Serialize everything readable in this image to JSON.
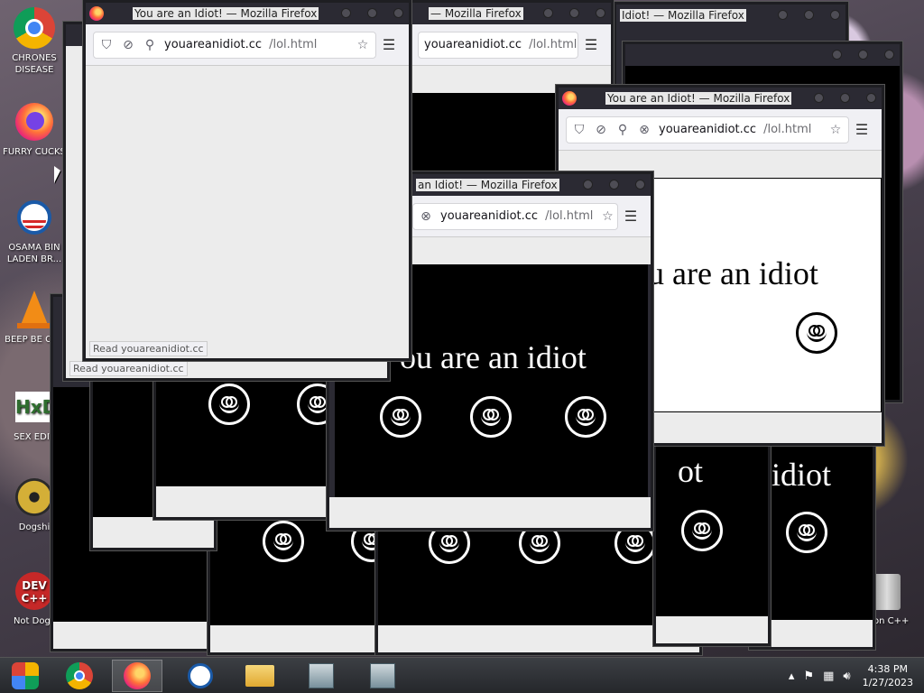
{
  "desktop": {
    "icons": [
      {
        "label": "CHRONES DISEASE",
        "icon": "chrome-icon"
      },
      {
        "label": "FURRY CUCKS",
        "icon": "firefox-icon"
      },
      {
        "label": "OSAMA BIN LADEN BR...",
        "icon": "obama-logo-icon"
      },
      {
        "label": "BEEP BE CAR",
        "icon": "vlc-cone-icon"
      },
      {
        "label": "SEX EDIT",
        "icon": "hxd-icon"
      },
      {
        "label": "Dogshi",
        "icon": "disc-icon"
      },
      {
        "label": "Not Dogs",
        "icon": "devcpp-icon"
      }
    ],
    "right_icon_label": "on C++"
  },
  "browser": {
    "title": "You are an Idiot! — Mozilla Firefox",
    "title_fragment_1": "an Idiot! — Mozilla Firefox",
    "title_fragment_2": "Idiot! — Mozilla Firefox",
    "title_fragment_3": "— Mozilla Firefox",
    "url_host": "youareanidiot.cc",
    "url_path": "/lol.html",
    "status_text": "Read youareanidiot.cc",
    "page_text": "You are an idiot",
    "page_text_partial": "ou are an idiot",
    "page_text_partial_2": "u are an idiot",
    "page_text_fragment_idiot": "idiot",
    "page_text_fragment_ot": "ot"
  },
  "taskbar": {
    "apps": [
      {
        "name": "media-center-icon"
      },
      {
        "name": "chrome-icon"
      },
      {
        "name": "firefox-icon",
        "active": true
      },
      {
        "name": "obama-logo-icon"
      },
      {
        "name": "file-explorer-icon"
      },
      {
        "name": "installer-icon"
      },
      {
        "name": "installer-icon-2"
      }
    ],
    "time": "4:38 PM",
    "date": "1/27/2023"
  },
  "colors": {
    "titlebar": "#2b2a33",
    "toolbar": "#f0f0f4",
    "page_black": "#000000"
  }
}
